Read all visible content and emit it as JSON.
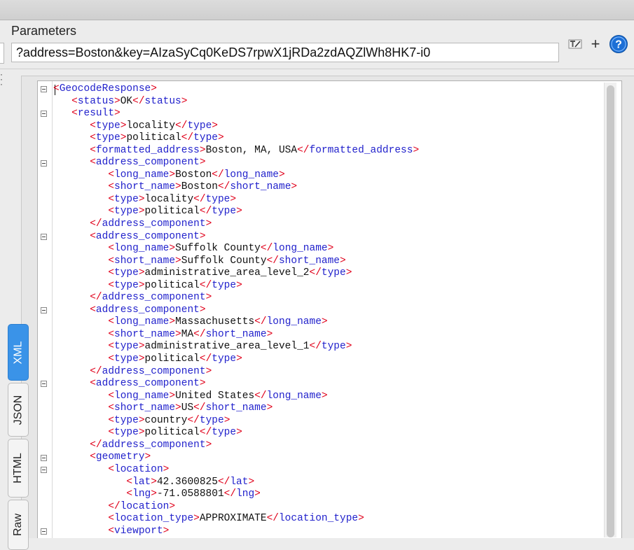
{
  "section_title": "Parameters",
  "params_value": "?address=Boston&key=AIzaSyCq0KeDS7rpwX1jRDa2zdAQZlWh8HK7-i0",
  "toolbar": {
    "format_icon": "format-icon",
    "add_icon": "+",
    "help_icon": "?"
  },
  "view_tabs": [
    "XML",
    "JSON",
    "HTML",
    "Raw"
  ],
  "active_tab": "XML",
  "colors": {
    "bracket": "#e0001a",
    "tag": "#2222cc",
    "text": "#111111",
    "active_tab": "#3a93e8"
  },
  "xml_lines": [
    {
      "indent": 0,
      "kind": "open",
      "tag": "GeocodeResponse",
      "fold": true
    },
    {
      "indent": 1,
      "kind": "leaf",
      "tag": "status",
      "text": "OK"
    },
    {
      "indent": 1,
      "kind": "open",
      "tag": "result",
      "fold": true
    },
    {
      "indent": 2,
      "kind": "leaf",
      "tag": "type",
      "text": "locality"
    },
    {
      "indent": 2,
      "kind": "leaf",
      "tag": "type",
      "text": "political"
    },
    {
      "indent": 2,
      "kind": "leaf",
      "tag": "formatted_address",
      "text": "Boston, MA, USA"
    },
    {
      "indent": 2,
      "kind": "open",
      "tag": "address_component",
      "fold": true
    },
    {
      "indent": 3,
      "kind": "leaf",
      "tag": "long_name",
      "text": "Boston"
    },
    {
      "indent": 3,
      "kind": "leaf",
      "tag": "short_name",
      "text": "Boston"
    },
    {
      "indent": 3,
      "kind": "leaf",
      "tag": "type",
      "text": "locality"
    },
    {
      "indent": 3,
      "kind": "leaf",
      "tag": "type",
      "text": "political"
    },
    {
      "indent": 2,
      "kind": "close",
      "tag": "address_component"
    },
    {
      "indent": 2,
      "kind": "open",
      "tag": "address_component",
      "fold": true
    },
    {
      "indent": 3,
      "kind": "leaf",
      "tag": "long_name",
      "text": "Suffolk County"
    },
    {
      "indent": 3,
      "kind": "leaf",
      "tag": "short_name",
      "text": "Suffolk County"
    },
    {
      "indent": 3,
      "kind": "leaf",
      "tag": "type",
      "text": "administrative_area_level_2"
    },
    {
      "indent": 3,
      "kind": "leaf",
      "tag": "type",
      "text": "political"
    },
    {
      "indent": 2,
      "kind": "close",
      "tag": "address_component"
    },
    {
      "indent": 2,
      "kind": "open",
      "tag": "address_component",
      "fold": true
    },
    {
      "indent": 3,
      "kind": "leaf",
      "tag": "long_name",
      "text": "Massachusetts"
    },
    {
      "indent": 3,
      "kind": "leaf",
      "tag": "short_name",
      "text": "MA"
    },
    {
      "indent": 3,
      "kind": "leaf",
      "tag": "type",
      "text": "administrative_area_level_1"
    },
    {
      "indent": 3,
      "kind": "leaf",
      "tag": "type",
      "text": "political"
    },
    {
      "indent": 2,
      "kind": "close",
      "tag": "address_component"
    },
    {
      "indent": 2,
      "kind": "open",
      "tag": "address_component",
      "fold": true
    },
    {
      "indent": 3,
      "kind": "leaf",
      "tag": "long_name",
      "text": "United States"
    },
    {
      "indent": 3,
      "kind": "leaf",
      "tag": "short_name",
      "text": "US"
    },
    {
      "indent": 3,
      "kind": "leaf",
      "tag": "type",
      "text": "country"
    },
    {
      "indent": 3,
      "kind": "leaf",
      "tag": "type",
      "text": "political"
    },
    {
      "indent": 2,
      "kind": "close",
      "tag": "address_component"
    },
    {
      "indent": 2,
      "kind": "open",
      "tag": "geometry",
      "fold": true
    },
    {
      "indent": 3,
      "kind": "open",
      "tag": "location",
      "fold": true
    },
    {
      "indent": 4,
      "kind": "leaf",
      "tag": "lat",
      "text": "42.3600825"
    },
    {
      "indent": 4,
      "kind": "leaf",
      "tag": "lng",
      "text": "-71.0588801"
    },
    {
      "indent": 3,
      "kind": "close",
      "tag": "location"
    },
    {
      "indent": 3,
      "kind": "leaf",
      "tag": "location_type",
      "text": "APPROXIMATE"
    },
    {
      "indent": 3,
      "kind": "open",
      "tag": "viewport",
      "fold": true
    }
  ]
}
